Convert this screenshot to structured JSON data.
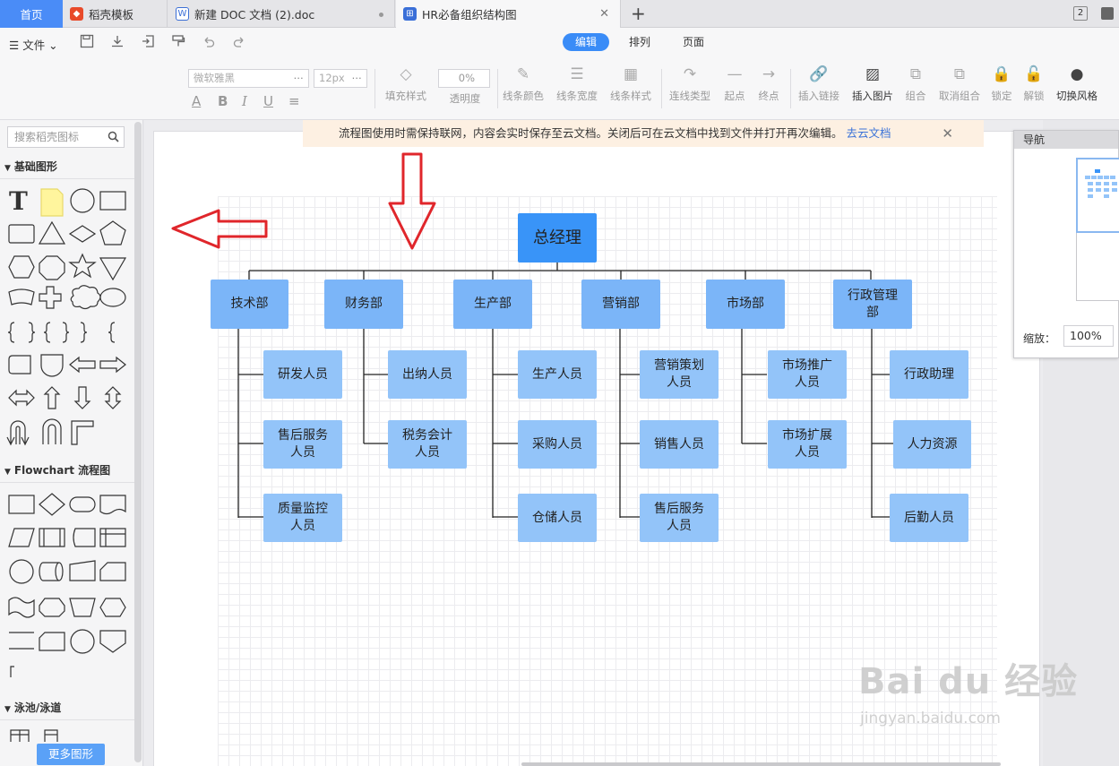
{
  "tabs": {
    "home": "首页",
    "t1": "稻壳模板",
    "t2": "新建 DOC 文档 (2).doc",
    "t3": "HR必备组织结构图",
    "count": "2"
  },
  "toolbar": {
    "file": "文件",
    "mode_tabs": [
      "编辑",
      "排列",
      "页面"
    ],
    "font_name": "微软雅黑",
    "font_size": "12px",
    "opacity_value": "0%",
    "fill_style": "填充样式",
    "opacity": "透明度",
    "line_color": "线条颜色",
    "line_width": "线条宽度",
    "line_style": "线条样式",
    "conn_type": "连线类型",
    "start": "起点",
    "end": "终点",
    "insert_link": "插入链接",
    "insert_image": "插入图片",
    "group": "组合",
    "ungroup": "取消组合",
    "lock": "锁定",
    "unlock": "解锁",
    "switch_style": "切换风格"
  },
  "left": {
    "search_placeholder": "搜索稻壳图标",
    "section_basic": "基础图形",
    "section_flowchart": "Flowchart 流程图",
    "section_pool": "泳池/泳道",
    "more_button": "更多图形"
  },
  "notice": {
    "text": "流程图使用时需保持联网，内容会实时保存至云文档。关闭后可在云文档中找到文件并打开再次编辑。",
    "link": "去云文档"
  },
  "org": {
    "top": "总经理",
    "depts": [
      {
        "name": "技术部",
        "subs": [
          "研发人员",
          "售后服务人员",
          "质量监控人员"
        ]
      },
      {
        "name": "财务部",
        "subs": [
          "出纳人员",
          "税务会计人员"
        ]
      },
      {
        "name": "生产部",
        "subs": [
          "生产人员",
          "采购人员",
          "仓储人员"
        ]
      },
      {
        "name": "营销部",
        "subs": [
          "营销策划人员",
          "销售人员",
          "售后服务人员"
        ]
      },
      {
        "name": "市场部",
        "subs": [
          "市场推广人员",
          "市场扩展人员"
        ]
      },
      {
        "name": "行政管理部",
        "subs": [
          "行政助理",
          "人力资源",
          "后勤人员"
        ]
      }
    ]
  },
  "nav": {
    "title": "导航",
    "zoom_label": "缩放：",
    "zoom_value": "100%"
  },
  "watermark": {
    "brand": "Bai du 经验",
    "url": "jingyan.baidu.com"
  }
}
